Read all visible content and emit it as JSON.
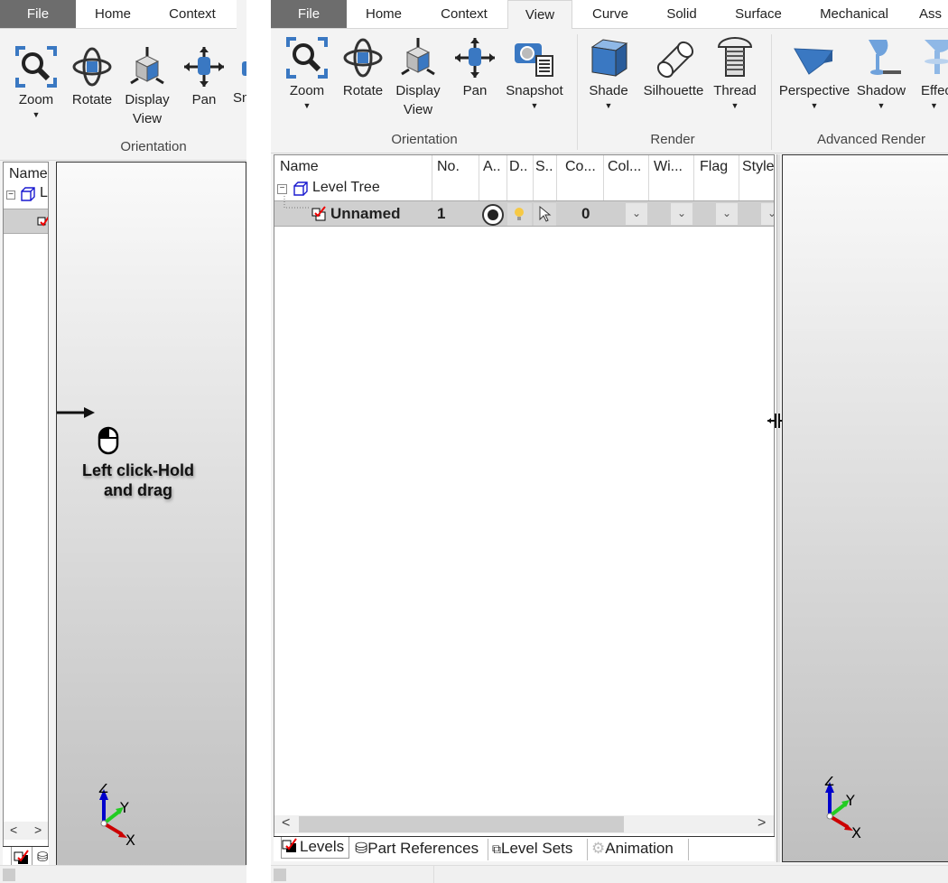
{
  "left_window": {
    "tabs": [
      "File",
      "Home",
      "Context"
    ],
    "ribbon": {
      "buttons": [
        "Zoom",
        "Rotate",
        "Display View",
        "Pan",
        "Sn"
      ],
      "display_view_line1": "Display",
      "display_view_line2": "View",
      "group": "Orientation"
    },
    "tree_header": "Name",
    "tree_root_label": "L",
    "scroll_left": "<",
    "scroll_right": ">"
  },
  "instruction": {
    "line1": "Left click-Hold",
    "line2": "and drag"
  },
  "right_window": {
    "tabs": [
      "File",
      "Home",
      "Context",
      "View",
      "Curve",
      "Solid",
      "Surface",
      "Mechanical",
      "Ass"
    ],
    "active_tab": "View",
    "ribbon": {
      "orientation": {
        "label": "Orientation",
        "buttons": [
          "Zoom",
          "Rotate",
          "Display",
          "Pan",
          "Snapshot"
        ],
        "display_view_line2": "View"
      },
      "render": {
        "label": "Render",
        "buttons": [
          "Shade",
          "Silhouette",
          "Thread"
        ]
      },
      "advanced_render": {
        "label": "Advanced Render",
        "buttons": [
          "Perspective",
          "Shadow",
          "Effec"
        ]
      }
    },
    "tree": {
      "columns": [
        "Name",
        "No.",
        "A..",
        "D..",
        "S..",
        "Co...",
        "Col...",
        "Wi...",
        "Flag",
        "Style"
      ],
      "root": "Level Tree",
      "rows": [
        {
          "name": "Unnamed",
          "no": "1",
          "count": "0"
        }
      ]
    },
    "bottom_tabs": [
      "Levels",
      "Part References",
      "Level Sets",
      "Animation"
    ],
    "active_bottom_tab": "Levels",
    "scroll_left": "<",
    "scroll_right": ">"
  },
  "axes": {
    "x": "X",
    "y": "Y",
    "z": "Z"
  },
  "colors": {
    "file_tab": "#6d6d6d",
    "icon_blue": "#3a78c2",
    "selected_row": "#cfcfcf",
    "axis_x": "#cc0000",
    "axis_y": "#22cc22",
    "axis_z": "#0000cc"
  }
}
